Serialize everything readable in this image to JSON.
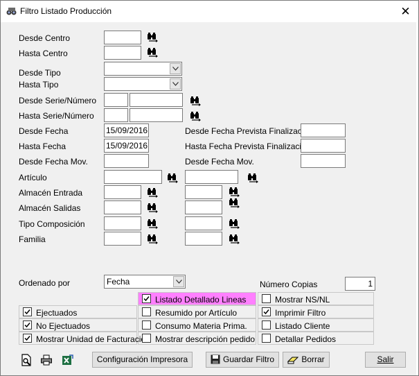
{
  "window": {
    "title": "Filtro Listado Producción",
    "close_glyph": "✕"
  },
  "labels": {
    "desde_centro": "Desde Centro",
    "hasta_centro": "Hasta Centro",
    "desde_tipo": "Desde Tipo",
    "hasta_tipo": "Hasta Tipo",
    "desde_serie": "Desde Serie/Número",
    "hasta_serie": "Hasta Serie/Número",
    "desde_fecha": "Desde Fecha",
    "hasta_fecha": "Hasta Fecha",
    "desde_fecha_mov": "Desde Fecha Mov.",
    "desde_fecha_prev": "Desde Fecha Prevista Finalización",
    "hasta_fecha_prev": "Hasta Fecha Prevista Finalización",
    "desde_fecha_mov_right": "Desde Fecha Mov.",
    "articulo": "Artículo",
    "almacen_entrada": "Almacén Entrada",
    "almacen_salidas": "Almacén Salidas",
    "tipo_composicion": "Tipo Composición",
    "familia": "Familia",
    "ordenado_por": "Ordenado por",
    "numero_copias": "Número Copias"
  },
  "values": {
    "desde_fecha": "15/09/2016",
    "hasta_fecha": "15/09/2016",
    "ordenado_por": "Fecha",
    "numero_copias": "1"
  },
  "options": {
    "listado_detallado": {
      "label": "Listado Detallado Lineas",
      "checked": true
    },
    "mostrar_ns_nl": {
      "label": "Mostrar NS/NL",
      "checked": false
    },
    "ejecutados": {
      "label": "Ejectuados",
      "checked": true
    },
    "resumido_articulo": {
      "label": "Resumido por Artículo",
      "checked": false
    },
    "imprimir_filtro": {
      "label": "Imprimir Filtro",
      "checked": true
    },
    "no_ejecutados": {
      "label": "No Ejectuados",
      "checked": true
    },
    "consumo_materia": {
      "label": "Consumo Materia Prima.",
      "checked": false
    },
    "listado_cliente": {
      "label": "Listado Cliente",
      "checked": false
    },
    "mostrar_unidad": {
      "label": "Mostrar Unidad de Facturación",
      "checked": true
    },
    "mostrar_descripcion": {
      "label": "Mostrar descripción pedido",
      "checked": false
    },
    "detallar_pedidos": {
      "label": "Detallar Pedidos",
      "checked": false
    }
  },
  "buttons": {
    "configuracion": "Configuración Impresora",
    "guardar": "Guardar Filtro",
    "borrar": "Borrar",
    "salir": "Salir"
  },
  "colors": {
    "highlight": "#ff80ff",
    "binocular": "#000000"
  }
}
